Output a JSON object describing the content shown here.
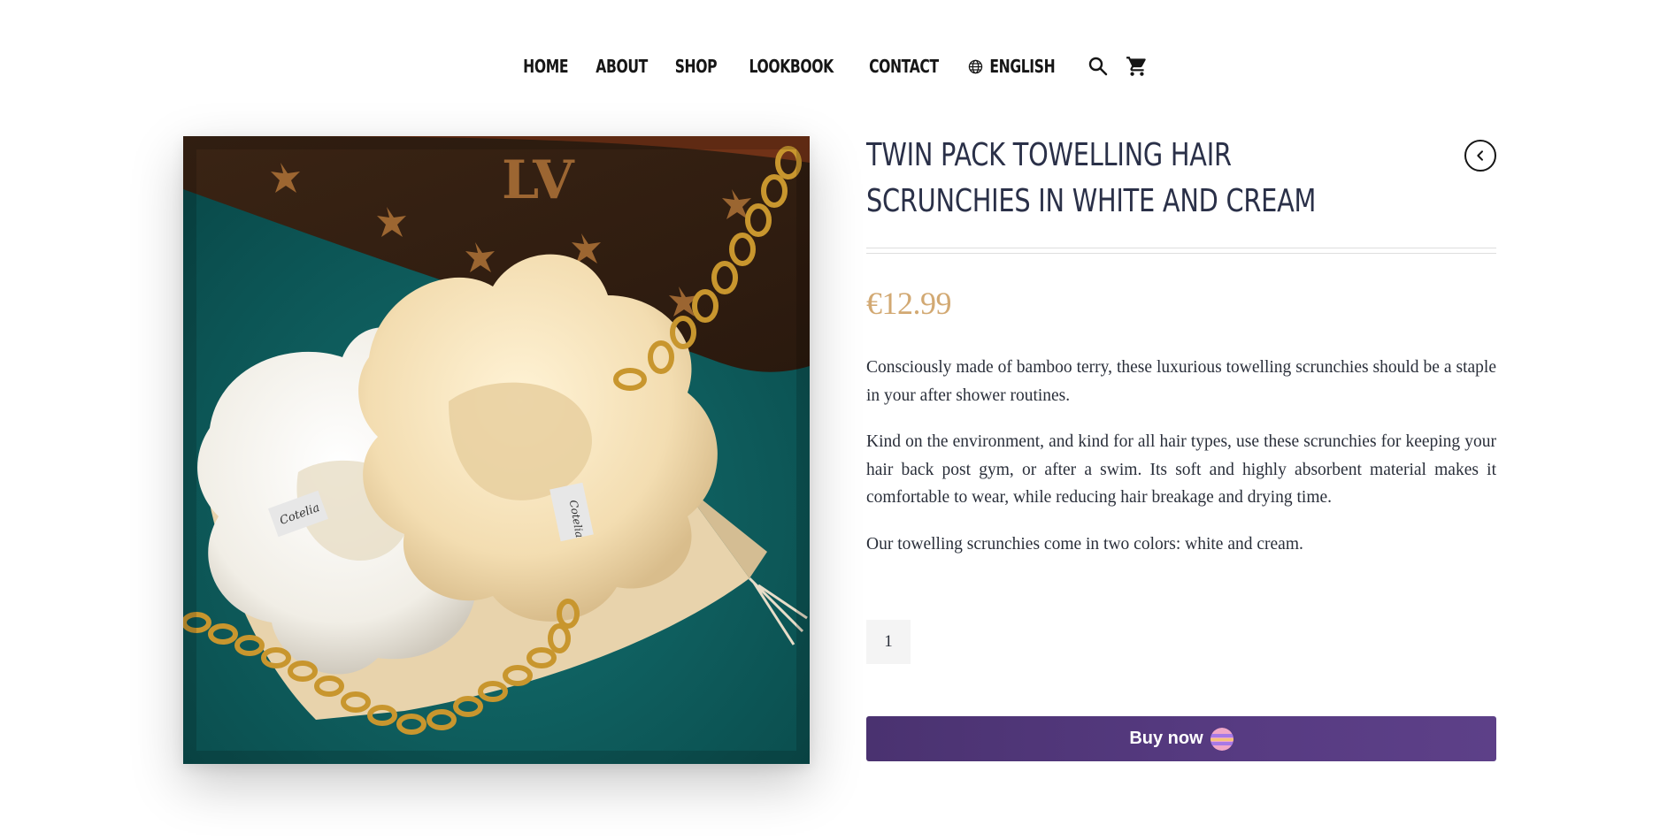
{
  "nav": {
    "items": [
      {
        "label": "HOME"
      },
      {
        "label": "ABOUT"
      },
      {
        "label": "SHOP"
      },
      {
        "label": "LOOKBOOK"
      },
      {
        "label": "CONTACT"
      }
    ],
    "language": "ENGLISH",
    "icons": {
      "language": "globe-icon",
      "search": "search-icon",
      "cart": "cart-icon"
    }
  },
  "product": {
    "image_alt": "Twin pack towelling hair scrunchies in white and cream",
    "title": "TWIN PACK TOWELLING HAIR SCRUNCHIES IN WHITE AND CREAM",
    "price": "€12.99",
    "description": [
      "Consciously made of bamboo terry, these luxurious towelling scrunchies should be a staple in your after shower routines.",
      "Kind on the environment, and kind for all hair types, use these scrunchies for keeping your hair back post gym, or after a swim. Its soft and highly absorbent material makes it comfortable to wear, while reducing hair breakage and drying time.",
      "Our towelling scrunchies come in two colors: white and cream."
    ],
    "quantity": "1",
    "buy_label": "Buy now",
    "back_icon": "chevron-left-icon",
    "label_text": "Cotelia"
  },
  "colors": {
    "accent_price": "#d2a973",
    "buy_button": "#4f3577",
    "title": "#2a3048"
  }
}
